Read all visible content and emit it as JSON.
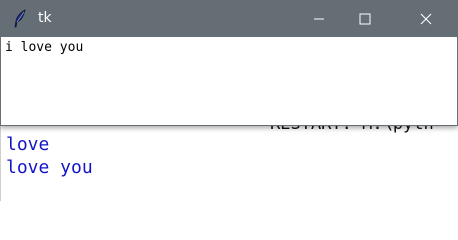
{
  "shell": {
    "restart_text": "RESTART: M:\\pyth",
    "output_lines": [
      "love",
      "love you"
    ],
    "output_color": "#1414c8"
  },
  "window": {
    "title": "tk",
    "titlebar_color": "#646e74",
    "icon": "feather-icon",
    "controls": {
      "minimize": "minimize-icon",
      "maximize": "maximize-icon",
      "close": "close-icon"
    },
    "label_text": "i love you"
  }
}
